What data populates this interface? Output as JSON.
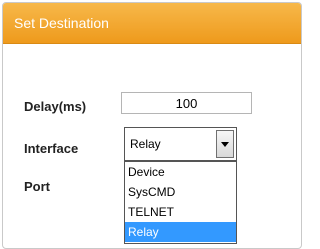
{
  "panel": {
    "title": "Set Destination",
    "header_color": "#f0a22a"
  },
  "form": {
    "delay_label": "Delay(ms)",
    "delay_value": "100",
    "interface_label": "Interface",
    "interface_selected": "Relay",
    "port_label": "Port"
  },
  "dropdown": {
    "options": [
      "Device",
      "SysCMD",
      "TELNET",
      "Relay"
    ],
    "highlighted": "Relay",
    "highlight_color": "#3399ff"
  }
}
